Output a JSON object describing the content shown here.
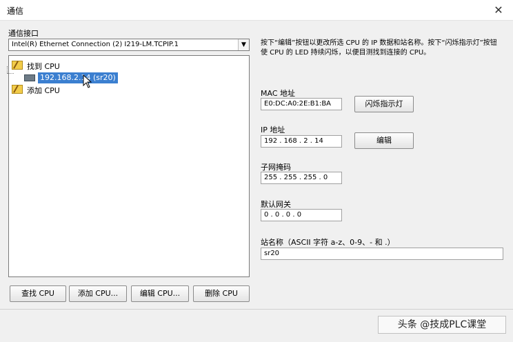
{
  "window": {
    "title": "通信",
    "close_glyph": "✕"
  },
  "interface": {
    "label": "通信接口",
    "selected": "Intel(R) Ethernet Connection (2) I219-LM.TCPIP.1",
    "dropdown_glyph": "▼"
  },
  "tree": {
    "found_label": "找到 CPU",
    "device_label": "192.168.2.14 (sr20)",
    "add_label": "添加 CPU"
  },
  "info": {
    "description": "按下“编辑”按钮以更改所选 CPU 的 IP 数据和站名称。按下“闪烁指示灯”按钮使 CPU 的 LED 持续闪烁，以便目测找到连接的 CPU。"
  },
  "mac": {
    "label": "MAC 地址",
    "value": "E0:DC:A0:2E:B1:BA",
    "blink_button": "闪烁指示灯"
  },
  "ip": {
    "label": "IP 地址",
    "value": "192 . 168 . 2 . 14",
    "edit_button": "编辑"
  },
  "subnet": {
    "label": "子网掩码",
    "value": "255 . 255 . 255 . 0"
  },
  "gateway": {
    "label": "默认网关",
    "value": "0 . 0 . 0 . 0"
  },
  "station": {
    "label": "站名称（ASCII 字符 a-z、0-9、- 和 .）",
    "value": "sr20"
  },
  "buttons": {
    "find": "查找 CPU",
    "add": "添加 CPU...",
    "edit": "编辑 CPU...",
    "delete": "删除 CPU"
  },
  "watermark": "头条 @技成PLC课堂",
  "colors": {
    "selection": "#3b7fd0",
    "folder": "#f2cc4a"
  }
}
